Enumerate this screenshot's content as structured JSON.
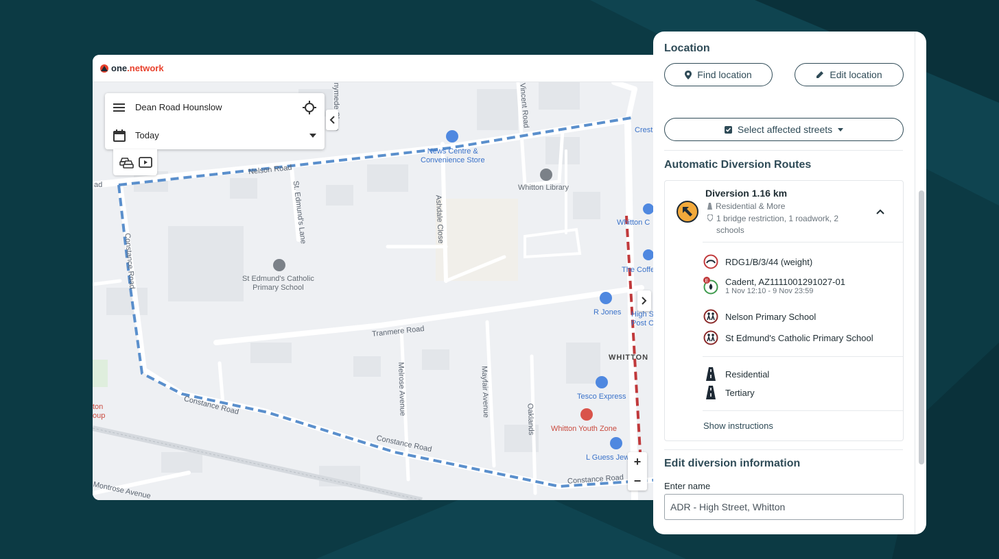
{
  "app": {
    "logo_one": "one",
    "logo_dot": ".",
    "logo_network": "network"
  },
  "search_panel": {
    "location": "Dean Road Hounslow",
    "date": "Today"
  },
  "map": {
    "labels": {
      "nelson_road": "Nelson Road",
      "constance_road_1": "Constance Road",
      "constance_road_2": "Constance Road",
      "constance_road_3": "Constance Road",
      "constance_road_4": "Constance Road",
      "tranmere_road": "Tranmere Road",
      "ashdale_close": "Ashdale Close",
      "st_edmunds_lane": "St. Edmund's Lane",
      "melrose_avenue": "Melrose Avenue",
      "mayfair_avenue": "Mayfair Avenue",
      "oaklands": "Oaklands",
      "vincent_road": "Vincent Road",
      "sunnymede": "Sunnymede Close",
      "whitton": "WHITTON",
      "montrose_avenue": "Montrose Avenue",
      "edge_ad": "ad"
    },
    "pois": {
      "news_centre": "News Centre &\nConvenience Store",
      "whitton_library": "Whitton Library",
      "st_edmunds_school": "St Edmund's Catholic\nPrimary School",
      "r_jones": "R Jones",
      "tesco_express": "Tesco Express",
      "whitton_youth_zone": "Whitton Youth Zone",
      "l_guess": "L Guess Jew",
      "whitton_c": "Whitton C",
      "the_coffee": "The Coffe",
      "high_st_post": "High S\nPost O",
      "crest": "Crest",
      "ton_oup": "ton\noup"
    },
    "zoom_in": "+",
    "zoom_out": "−"
  },
  "side_panel": {
    "location_title": "Location",
    "find_location": "Find location",
    "edit_location": "Edit location",
    "select_streets": "Select affected streets",
    "auto_routes_title": "Automatic Diversion Routes",
    "diversion": {
      "title": "Diversion 1.16 km",
      "road_types": "Residential & More",
      "restrictions": "1 bridge restriction, 1 roadwork, 2",
      "restrictions_2": "schools",
      "items": [
        {
          "label": "RDG1/B/3/44 (weight)",
          "sub": "",
          "icon": "bridge-restriction-icon"
        },
        {
          "label": "Cadent, AZ1111001291027-01",
          "sub": "1 Nov 12:10 - 9 Nov 23:59",
          "icon": "roadwork-icon"
        },
        {
          "label": "Nelson Primary School",
          "sub": "",
          "icon": "school-icon"
        },
        {
          "label": "St Edmund's Catholic Primary School",
          "sub": "",
          "icon": "school-icon"
        }
      ],
      "road_classes": [
        "Residential",
        "Tertiary"
      ],
      "show_instructions": "Show instructions"
    },
    "edit_title": "Edit diversion information",
    "name_label": "Enter name",
    "name_value": "ADR - High Street, Whitton"
  },
  "colors": {
    "background": "#0c3a44",
    "accent": "#2f4b57",
    "diversion_route": "#5a8fcc",
    "closure": "#c0393b",
    "diversion_marker": "#f2a93b"
  }
}
